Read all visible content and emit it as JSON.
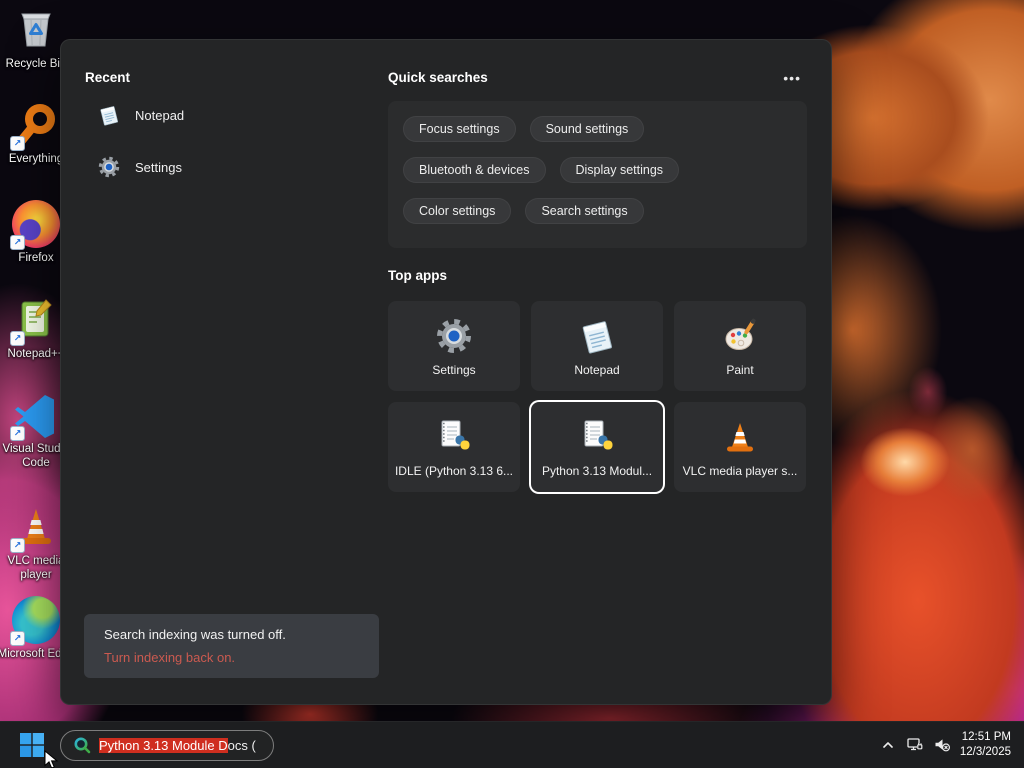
{
  "colors": {
    "selection_red": "#cf2e1f",
    "link_red": "#cb5a50",
    "panel_bg": "#242526",
    "tile_bg": "#2d2e30",
    "accent_blue": "#2f9df0"
  },
  "desktop": {
    "icons": [
      {
        "label": "Recycle Bin"
      },
      {
        "label": "Everything"
      },
      {
        "label": "Firefox"
      },
      {
        "label": "Notepad++"
      },
      {
        "label": "Visual Studio Code"
      },
      {
        "label": "VLC media player"
      },
      {
        "label": "Microsoft Edge"
      }
    ]
  },
  "panel": {
    "recent": {
      "title": "Recent",
      "items": [
        {
          "label": "Notepad"
        },
        {
          "label": "Settings"
        }
      ]
    },
    "quick": {
      "title": "Quick searches",
      "more": "•••",
      "pills": [
        "Focus settings",
        "Sound settings",
        "Bluetooth & devices",
        "Display settings",
        "Color settings",
        "Search settings"
      ]
    },
    "top_apps": {
      "title": "Top apps",
      "tiles": [
        {
          "label": "Settings"
        },
        {
          "label": "Notepad"
        },
        {
          "label": "Paint"
        },
        {
          "label": "IDLE (Python 3.13 6..."
        },
        {
          "label": "Python 3.13 Modul..."
        },
        {
          "label": "VLC media player s..."
        }
      ]
    },
    "notice": {
      "line1": "Search indexing was turned off.",
      "link": "Turn indexing back on."
    }
  },
  "taskbar": {
    "search": {
      "selected_text": "Python 3.13 Module D",
      "rest_text": "ocs ("
    },
    "clock": {
      "time": "12:51 PM",
      "date": "12/3/2025"
    }
  }
}
